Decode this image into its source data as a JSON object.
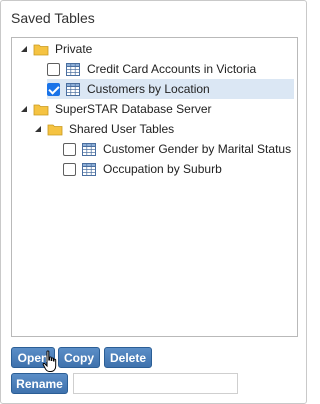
{
  "panel": {
    "title": "Saved Tables"
  },
  "tree": {
    "private": {
      "label": "Private",
      "items": [
        {
          "label": "Credit Card Accounts in Victoria",
          "checked": false
        },
        {
          "label": "Customers by Location",
          "checked": true
        }
      ]
    },
    "server": {
      "label": "SuperSTAR Database Server",
      "shared": {
        "label": "Shared User Tables",
        "items": [
          {
            "label": "Customer Gender by Marital Status",
            "checked": false
          },
          {
            "label": "Occupation by Suburb",
            "checked": false
          }
        ]
      }
    }
  },
  "buttons": {
    "open": "Open",
    "copy": "Copy",
    "delete": "Delete",
    "rename": "Rename"
  },
  "rename_input": {
    "value": ""
  },
  "colors": {
    "button_bg": "#4a7fbb",
    "selected_row": "#dbe7f4",
    "folder": "#f5c342"
  },
  "icons": {
    "expanded": "triangle-expanded-icon",
    "folder": "folder-icon",
    "table": "table-icon",
    "cursor": "hand-pointer-icon"
  }
}
